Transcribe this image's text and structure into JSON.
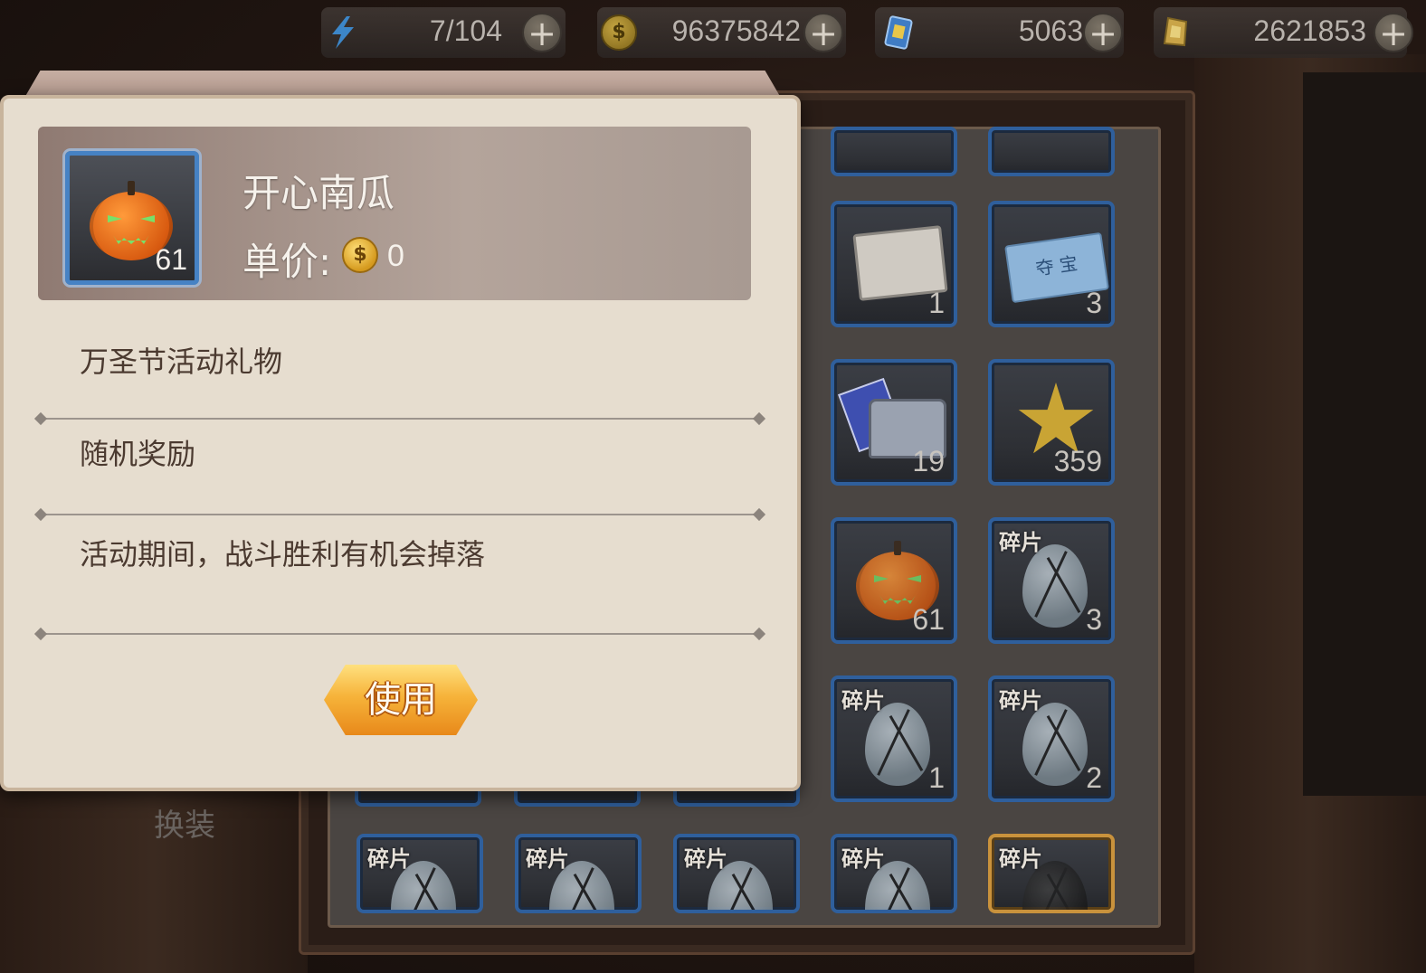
{
  "topbar": {
    "energy": {
      "icon": "lightning-icon",
      "value": "7/104"
    },
    "gold": {
      "icon": "coin-icon",
      "value": "96375842"
    },
    "tickets": {
      "icon": "card-pack-icon",
      "value": "5063"
    },
    "gems": {
      "icon": "gem-icon",
      "value": "2621853"
    },
    "plus_glyph": "+",
    "coin_glyph": "$"
  },
  "side": {
    "outfit_label": "换装"
  },
  "dialog": {
    "item_name": "开心南瓜",
    "item_count": "61",
    "price_label": "单价:",
    "price_coin_glyph": "$",
    "price_value": "0",
    "descriptions": [
      "万圣节活动礼物",
      "随机奖励",
      "活动期间，战斗胜利有机会掉落"
    ],
    "use_button": "使用"
  },
  "inventory": {
    "fragment_tag": "碎片",
    "ticket_text": "夺 宝",
    "slots": [
      {
        "count": "1",
        "icon": "lucky-cat-card-icon"
      },
      {
        "count": "3",
        "icon": "treasure-ticket-icon"
      },
      {
        "count": "19",
        "icon": "card-chest-icon"
      },
      {
        "count": "359",
        "icon": "gold-star-icon"
      },
      {
        "count": "61",
        "icon": "pumpkin-icon"
      },
      {
        "count": "3",
        "icon": "egg-fragment-icon",
        "fragment": true
      },
      {
        "count": "1",
        "icon": "egg-fragment-icon",
        "fragment": true
      },
      {
        "count": "2",
        "icon": "egg-fragment-icon",
        "fragment": true
      }
    ]
  },
  "colors": {
    "slot_border": "#2f5f9c",
    "gold_slot_border": "#c9923c",
    "dialog_bg": "#e6ddcf",
    "button_orange": "#f6b33a"
  }
}
